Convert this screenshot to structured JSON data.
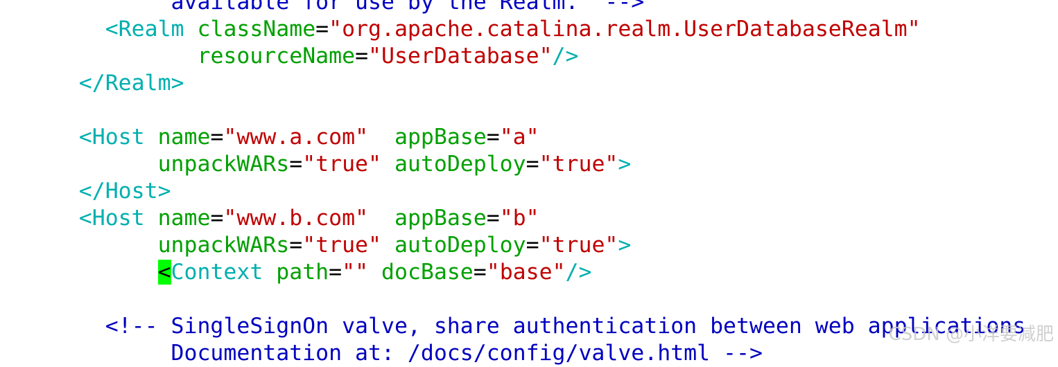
{
  "code_lines": [
    {
      "id": "l0",
      "tokens": [
        {
          "cls": "c-comment",
          "text": "             available for use by the Realm.  -->"
        }
      ]
    },
    {
      "id": "l1",
      "tokens": [
        {
          "cls": "c-tag",
          "text": "        <Realm"
        },
        {
          "cls": "c-plain",
          "text": " "
        },
        {
          "cls": "c-attr",
          "text": "className"
        },
        {
          "cls": "c-plain",
          "text": "="
        },
        {
          "cls": "c-str",
          "text": "\"org.apache.catalina.realm.UserDatabaseRealm\""
        }
      ]
    },
    {
      "id": "l2",
      "tokens": [
        {
          "cls": "c-plain",
          "text": "               "
        },
        {
          "cls": "c-attr",
          "text": "resourceName"
        },
        {
          "cls": "c-plain",
          "text": "="
        },
        {
          "cls": "c-str",
          "text": "\"UserDatabase\""
        },
        {
          "cls": "c-tag",
          "text": "/>"
        }
      ]
    },
    {
      "id": "l3",
      "tokens": [
        {
          "cls": "c-tag",
          "text": "      </Realm>"
        }
      ]
    },
    {
      "id": "l4",
      "tokens": [
        {
          "cls": "c-plain",
          "text": " "
        }
      ]
    },
    {
      "id": "l5",
      "tokens": [
        {
          "cls": "c-tag",
          "text": "      <Host"
        },
        {
          "cls": "c-plain",
          "text": " "
        },
        {
          "cls": "c-attr",
          "text": "name"
        },
        {
          "cls": "c-plain",
          "text": "="
        },
        {
          "cls": "c-str",
          "text": "\"www.a.com\""
        },
        {
          "cls": "c-plain",
          "text": "  "
        },
        {
          "cls": "c-attr",
          "text": "appBase"
        },
        {
          "cls": "c-plain",
          "text": "="
        },
        {
          "cls": "c-str",
          "text": "\"a\""
        }
      ]
    },
    {
      "id": "l6",
      "tokens": [
        {
          "cls": "c-plain",
          "text": "            "
        },
        {
          "cls": "c-attr",
          "text": "unpackWARs"
        },
        {
          "cls": "c-plain",
          "text": "="
        },
        {
          "cls": "c-str",
          "text": "\"true\""
        },
        {
          "cls": "c-plain",
          "text": " "
        },
        {
          "cls": "c-attr",
          "text": "autoDeploy"
        },
        {
          "cls": "c-plain",
          "text": "="
        },
        {
          "cls": "c-str",
          "text": "\"true\""
        },
        {
          "cls": "c-tag",
          "text": ">"
        }
      ]
    },
    {
      "id": "l7",
      "tokens": [
        {
          "cls": "c-tag",
          "text": "      </Host>"
        }
      ]
    },
    {
      "id": "l8",
      "tokens": [
        {
          "cls": "c-tag",
          "text": "      <Host"
        },
        {
          "cls": "c-plain",
          "text": " "
        },
        {
          "cls": "c-attr",
          "text": "name"
        },
        {
          "cls": "c-plain",
          "text": "="
        },
        {
          "cls": "c-str",
          "text": "\"www.b.com\""
        },
        {
          "cls": "c-plain",
          "text": "  "
        },
        {
          "cls": "c-attr",
          "text": "appBase"
        },
        {
          "cls": "c-plain",
          "text": "="
        },
        {
          "cls": "c-str",
          "text": "\"b\""
        }
      ]
    },
    {
      "id": "l9",
      "tokens": [
        {
          "cls": "c-plain",
          "text": "            "
        },
        {
          "cls": "c-attr",
          "text": "unpackWARs"
        },
        {
          "cls": "c-plain",
          "text": "="
        },
        {
          "cls": "c-str",
          "text": "\"true\""
        },
        {
          "cls": "c-plain",
          "text": " "
        },
        {
          "cls": "c-attr",
          "text": "autoDeploy"
        },
        {
          "cls": "c-plain",
          "text": "="
        },
        {
          "cls": "c-str",
          "text": "\"true\""
        },
        {
          "cls": "c-tag",
          "text": ">"
        }
      ]
    },
    {
      "id": "l10",
      "tokens": [
        {
          "cls": "c-plain",
          "text": "            "
        },
        {
          "cls": "c-tag cursor",
          "text": "<"
        },
        {
          "cls": "c-tag",
          "text": "Context"
        },
        {
          "cls": "c-plain",
          "text": " "
        },
        {
          "cls": "c-attr",
          "text": "path"
        },
        {
          "cls": "c-plain",
          "text": "="
        },
        {
          "cls": "c-str",
          "text": "\"\""
        },
        {
          "cls": "c-plain",
          "text": " "
        },
        {
          "cls": "c-attr",
          "text": "docBase"
        },
        {
          "cls": "c-plain",
          "text": "="
        },
        {
          "cls": "c-str",
          "text": "\"base\""
        },
        {
          "cls": "c-tag",
          "text": "/>"
        }
      ]
    },
    {
      "id": "l11",
      "tokens": [
        {
          "cls": "c-plain",
          "text": " "
        }
      ]
    },
    {
      "id": "l12",
      "tokens": [
        {
          "cls": "c-comment",
          "text": "        <!-- SingleSignOn valve, share authentication between web applications"
        }
      ]
    },
    {
      "id": "l13",
      "tokens": [
        {
          "cls": "c-comment",
          "text": "             Documentation at: /docs/config/valve.html -->"
        }
      ]
    }
  ],
  "watermark": "CSDN @小洋要减肥",
  "colors": {
    "comment": "#0000c0",
    "tag": "#00afaf",
    "attribute": "#00a000",
    "string": "#c00000",
    "cursor": "#00ff00"
  }
}
